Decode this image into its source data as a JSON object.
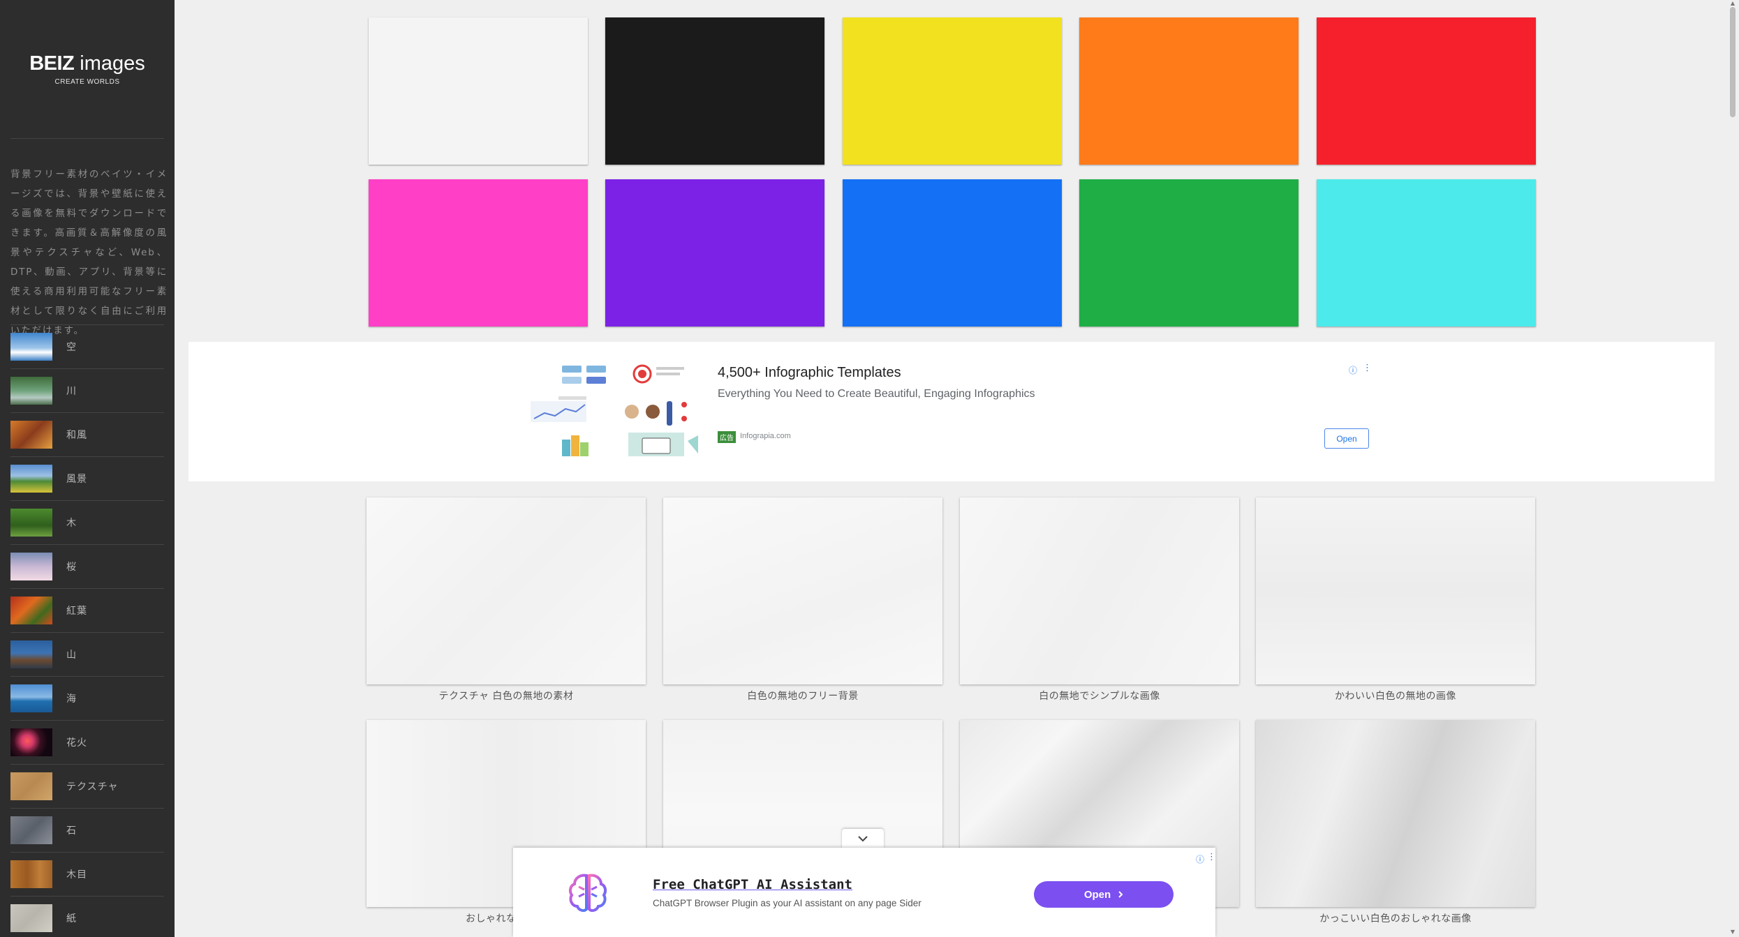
{
  "logo": {
    "brand": "BEIZ",
    "suffix": " images",
    "tagline": "CREATE WORLDS"
  },
  "intro": "背景フリー素材のベイツ・イメージズでは、背景や壁紙に使える画像を無料でダウンロードできます。高画質＆高解像度の風景やテクスチャなど、Web、DTP、動画、アプリ、背景等に使える商用利用可能なフリー素材として限りなく自由にご利用いただけます。",
  "sidebar": {
    "items": [
      {
        "label": "空"
      },
      {
        "label": "川"
      },
      {
        "label": "和風"
      },
      {
        "label": "風景"
      },
      {
        "label": "木"
      },
      {
        "label": "桜"
      },
      {
        "label": "紅葉"
      },
      {
        "label": "山"
      },
      {
        "label": "海"
      },
      {
        "label": "花火"
      },
      {
        "label": "テクスチャ"
      },
      {
        "label": "石"
      },
      {
        "label": "木目"
      },
      {
        "label": "紙"
      }
    ]
  },
  "swatches": [
    {
      "color": "#f4f4f4"
    },
    {
      "color": "#1b1b1b"
    },
    {
      "color": "#f2e11f"
    },
    {
      "color": "#ff7b1a"
    },
    {
      "color": "#f5202b"
    },
    {
      "color": "#ff3fc6"
    },
    {
      "color": "#7b22e6"
    },
    {
      "color": "#1470f5"
    },
    {
      "color": "#1fae46"
    },
    {
      "color": "#4ceaea"
    }
  ],
  "ad": {
    "title": "4,500+ Infographic Templates",
    "description": "Everything You Need to Create Beautiful, Engaging Infographics",
    "badge": "広告",
    "domain": "Infograpia.com",
    "open_label": "Open"
  },
  "cards": [
    {
      "caption": "テクスチャ 白色の無地の素材"
    },
    {
      "caption": "白色の無地のフリー背景"
    },
    {
      "caption": "白の無地でシンプルな画像"
    },
    {
      "caption": "かわいい白色の無地の画像"
    },
    {
      "caption": "おしゃれな白色の"
    },
    {
      "caption": ""
    },
    {
      "caption": ""
    },
    {
      "caption": "かっこいい白色のおしゃれな画像"
    }
  ],
  "sticky_ad": {
    "title": "Free ChatGPT AI Assistant",
    "description": "ChatGPT Browser Plugin as your AI assistant on any page Sider",
    "open_label": "Open"
  }
}
